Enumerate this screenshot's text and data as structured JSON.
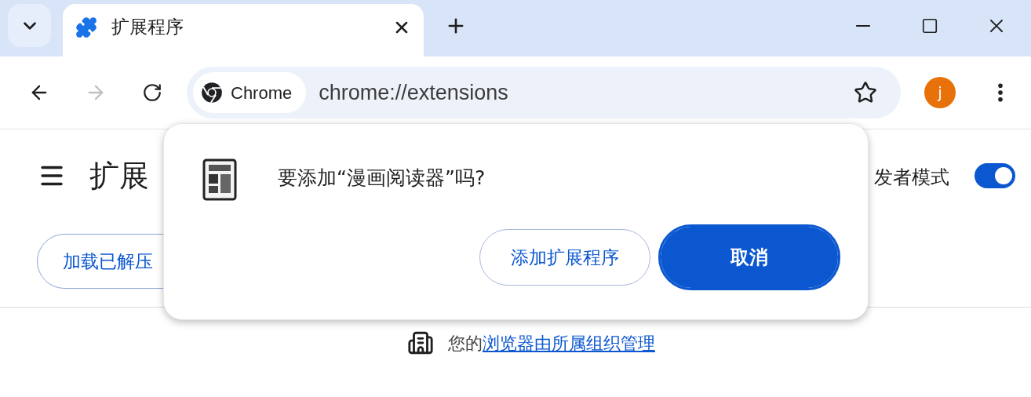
{
  "tab_strip": {
    "tabs": [
      {
        "title": "扩展程序",
        "selected": true
      }
    ]
  },
  "toolbar": {
    "nav_buttons": [
      {
        "kind": "back",
        "disabled": false
      },
      {
        "kind": "forward",
        "disabled": true
      },
      {
        "kind": "reload",
        "disabled": false
      }
    ],
    "omnibox": {
      "chip": "Chrome",
      "url": "chrome://extensions"
    },
    "avatar": "j"
  },
  "page": {
    "title": "扩展",
    "load_unpacked_button": "加载已解压",
    "developer_mode": {
      "label": "发者模式",
      "on": true
    },
    "managed_notice": {
      "prefix": "您的",
      "link": "浏览器由所属组织管理"
    }
  },
  "dialog": {
    "question": "要添加“漫画阅读器”吗?",
    "buttons": [
      {
        "label": "添加扩展程序",
        "kind": "secondary"
      },
      {
        "label": "取消",
        "kind": "primary"
      }
    ]
  }
}
